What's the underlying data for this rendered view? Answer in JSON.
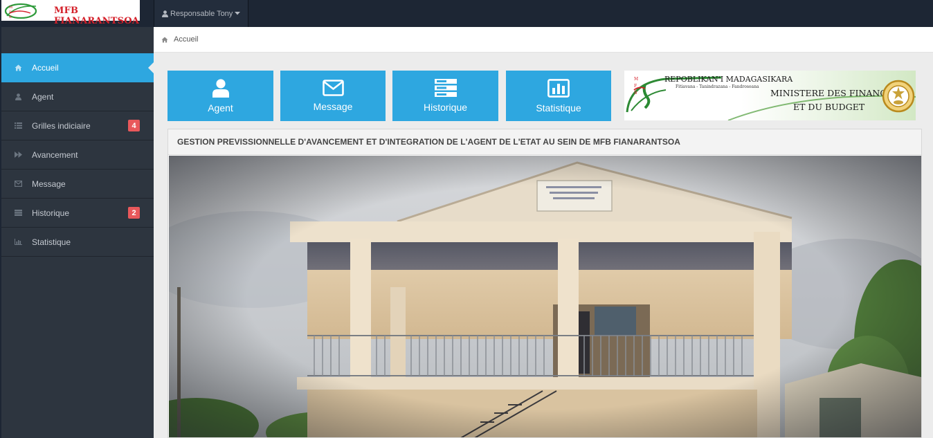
{
  "brand": {
    "name": "MFB FIANARANTSOA",
    "logo_text": "MFB"
  },
  "user_menu": {
    "label": "Responsable Tony",
    "icon": "user-icon",
    "caret": "caret-down-icon"
  },
  "sidebar": {
    "items": [
      {
        "label": "Accueil",
        "icon": "home-icon",
        "active": true
      },
      {
        "label": "Agent",
        "icon": "user-icon"
      },
      {
        "label": "Grilles indiciaire",
        "icon": "list-icon",
        "badge": "4"
      },
      {
        "label": "Avancement",
        "icon": "forward-icon"
      },
      {
        "label": "Message",
        "icon": "envelope-icon"
      },
      {
        "label": "Historique",
        "icon": "server-icon",
        "badge": "2"
      },
      {
        "label": "Statistique",
        "icon": "bar-chart-icon"
      }
    ]
  },
  "breadcrumb": {
    "label": "Accueil",
    "icon": "home-icon"
  },
  "tiles": [
    {
      "label": "Agent",
      "icon": "user-icon"
    },
    {
      "label": "Message",
      "icon": "envelope-icon"
    },
    {
      "label": "Historique",
      "icon": "server-icon"
    },
    {
      "label": "Statistique",
      "icon": "bar-chart-icon"
    }
  ],
  "banner": {
    "line1": "REPOBLIKAN'I MADAGASIKARA",
    "line2": "Fitiavana - Tanindrazana - Fandrosoana",
    "line3": "MINISTERE DES FINANCES",
    "line4": "ET DU BUDGET"
  },
  "panel": {
    "title": "GESTION PREVISSIONNELLE D'AVANCEMENT ET D'INTEGRATION DE L'AGENT DE L'ETAT AU SEIN DE MFB FIANARANTSOA"
  },
  "colors": {
    "navbar": "#1d2634",
    "sidebar": "#2d353f",
    "accent": "#2ea7e0",
    "badge": "#e8585b",
    "brand_red": "#d4202a"
  }
}
